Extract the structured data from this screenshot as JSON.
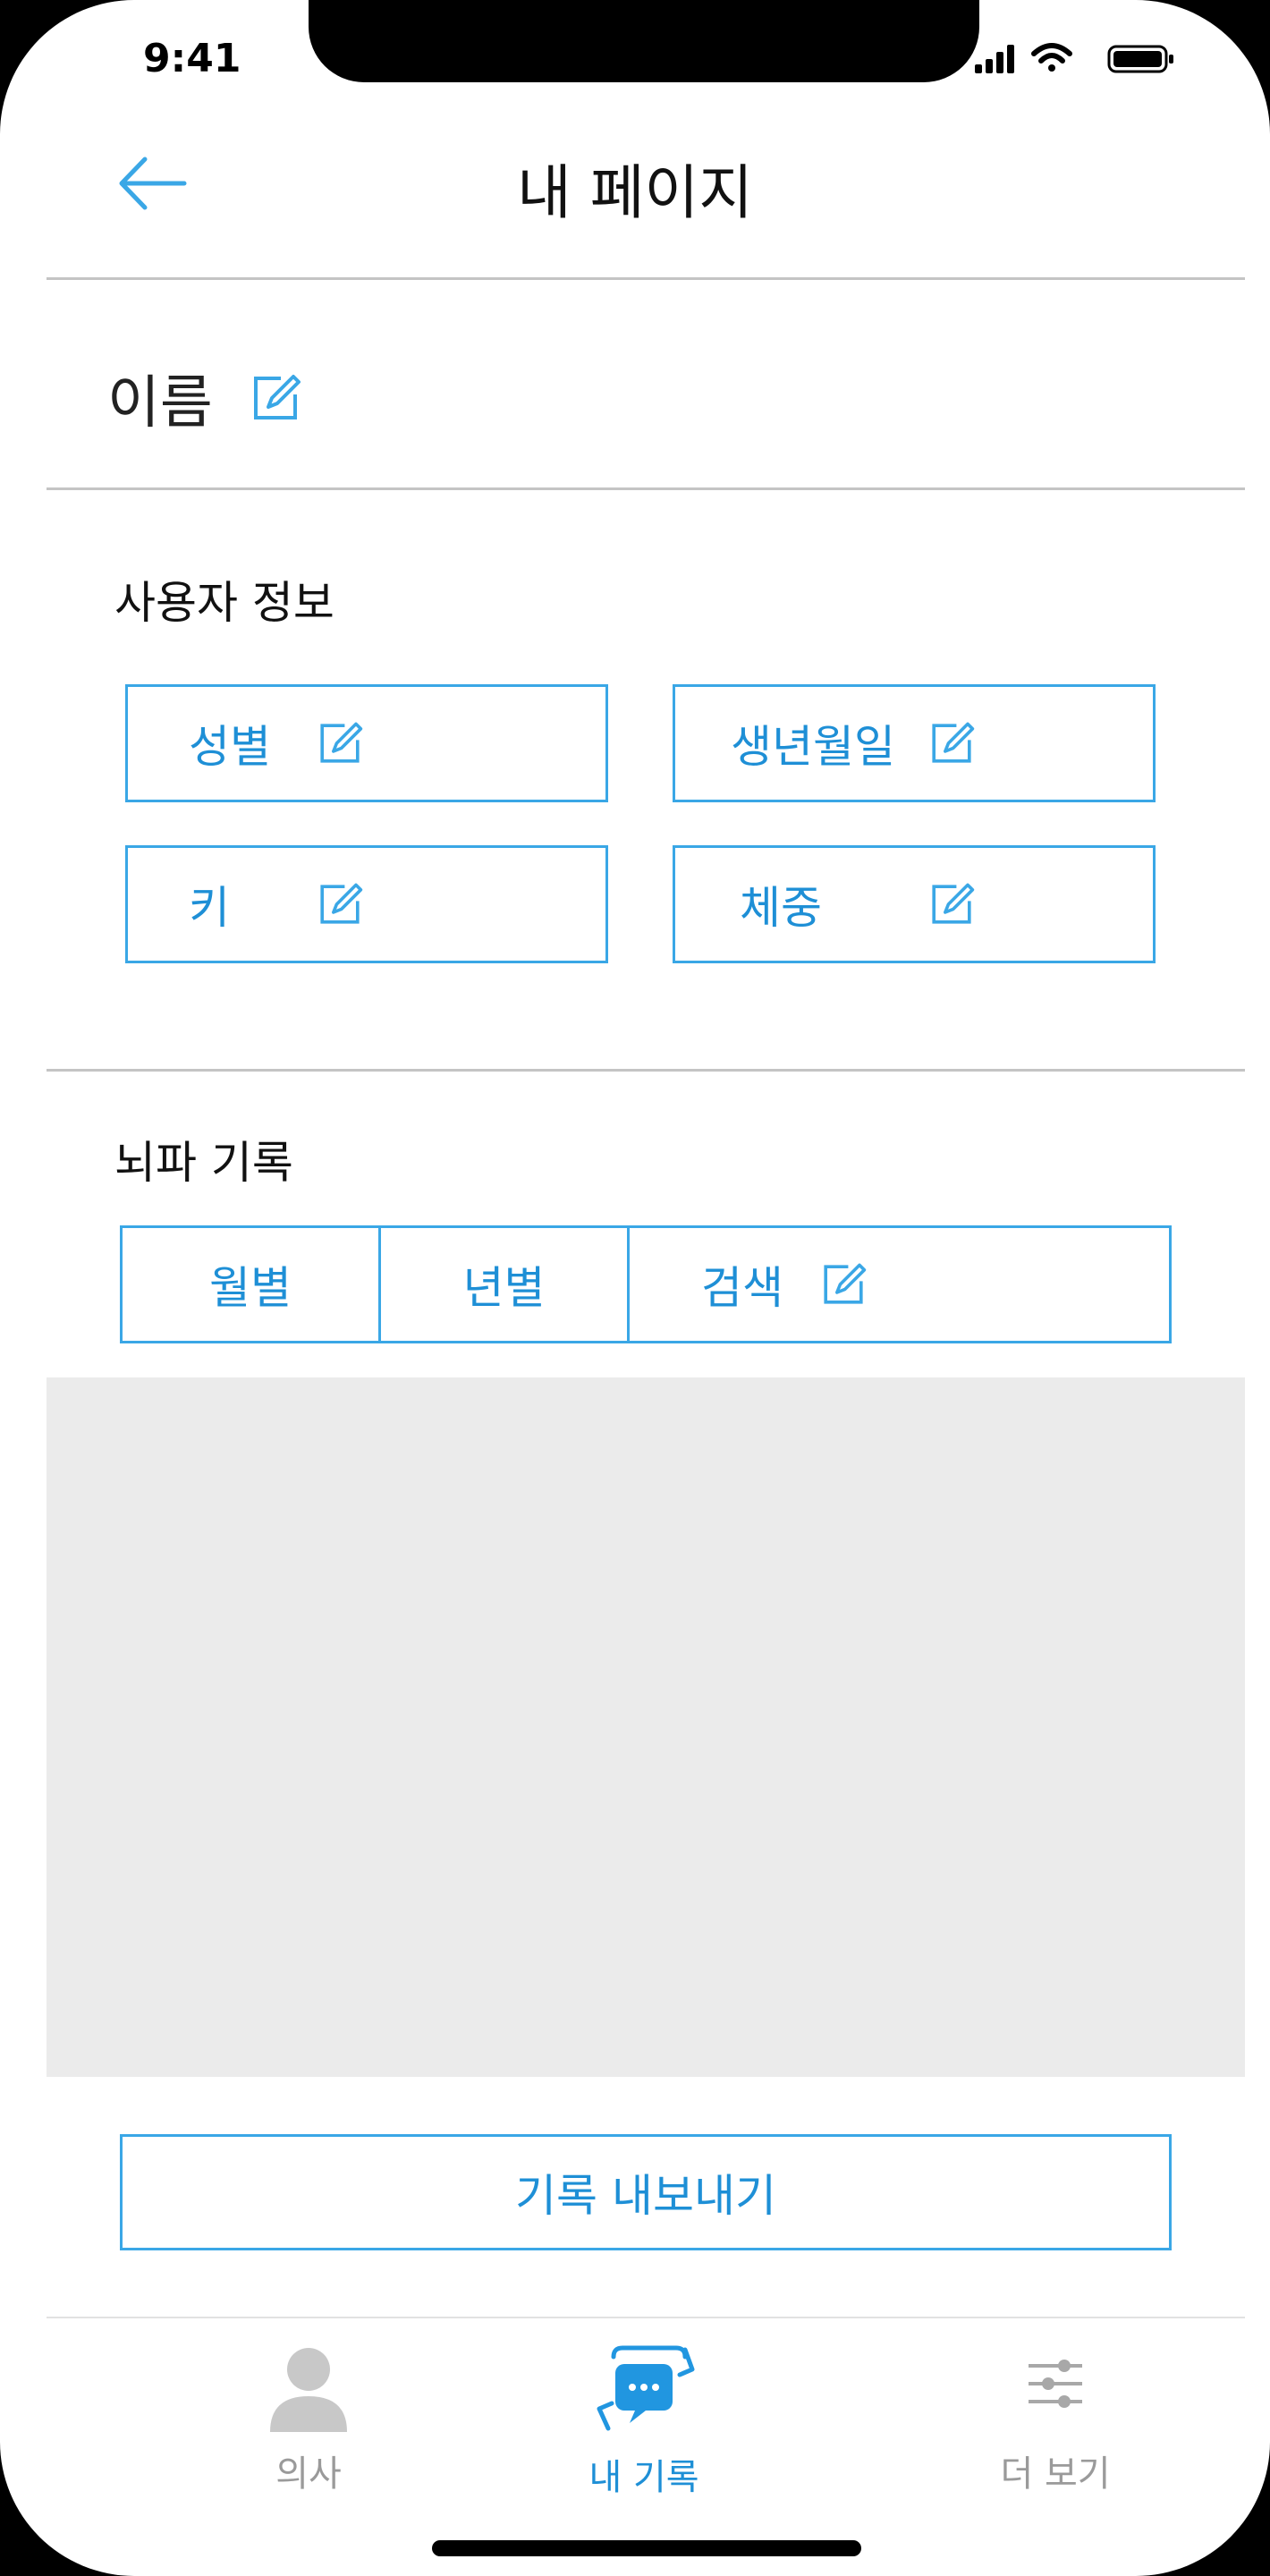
{
  "status_bar": {
    "time": "9:41"
  },
  "header": {
    "title": "내 페이지"
  },
  "profile": {
    "name_label": "이름"
  },
  "user_info": {
    "title": "사용자 정보",
    "fields": [
      "성별",
      "생년월일",
      "키",
      "체중"
    ]
  },
  "eeg_records": {
    "title": "뇌파 기록",
    "tabs": [
      "월별",
      "년별",
      "검색"
    ]
  },
  "export_button": {
    "label": "기록 내보내기"
  },
  "tab_bar": {
    "items": [
      {
        "label": "의사",
        "active": false
      },
      {
        "label": "내 기록",
        "active": true
      },
      {
        "label": "더 보기",
        "active": false
      }
    ]
  },
  "colors": {
    "accent": "#3aa7e6",
    "accent_text": "#1e8fd6",
    "inactive": "#9a9a9a",
    "placeholder_bg": "#ebebeb"
  }
}
